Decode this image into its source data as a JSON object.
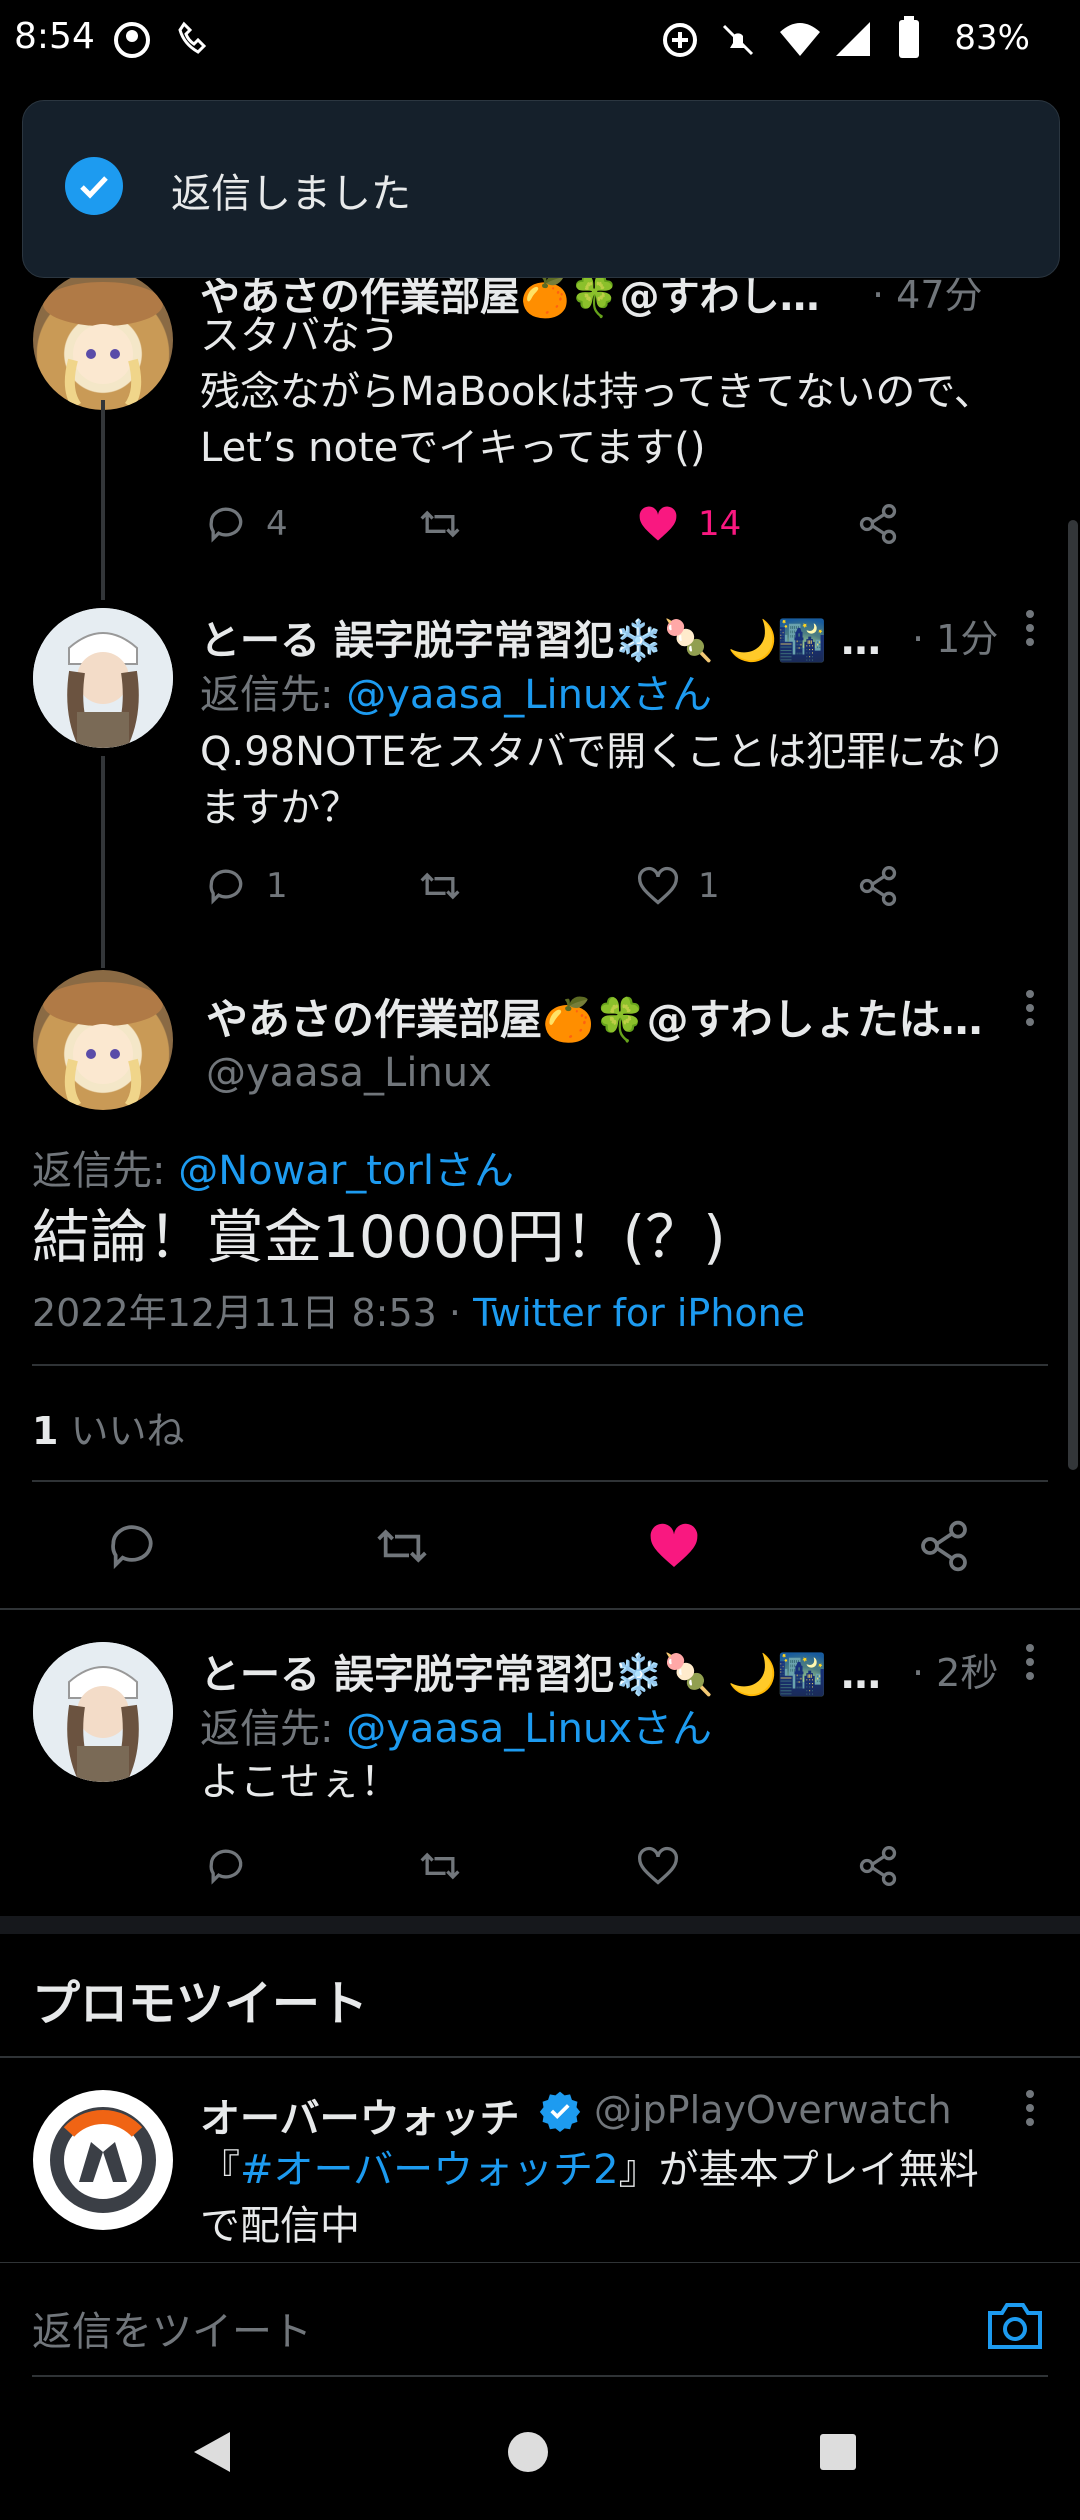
{
  "status": {
    "time": "8:54",
    "battery": "83%"
  },
  "toast": {
    "text": "返信しました"
  },
  "tweets": [
    {
      "author": "やあさの作業部屋🍊🍀@すわし…",
      "time": "· 47分",
      "lines": [
        "スタバなう",
        "残念ながらMaBookは持ってきてないので、",
        "Let’s noteでイキってます()"
      ],
      "replies": "4",
      "likes": "14"
    },
    {
      "author": "とーる 誤字脱字常習犯❄️🍡 🌙🌃 …",
      "time": "· 1分",
      "reply_to_prefix": "返信先: ",
      "reply_to": "@yaasa_Linuxさん",
      "lines": [
        "Q.98NOTEをスタバで開くことは犯罪になり",
        "ますか？"
      ],
      "replies": "1",
      "likes": "1"
    }
  ],
  "main_tweet": {
    "author": "やあさの作業部屋🍊🍀@すわしょたは…",
    "handle": "@yaasa_Linux",
    "reply_to_prefix": "返信先: ",
    "reply_to": "@Nowar_torlさん",
    "text": "結論！賞金10000円！(？)",
    "date": "2022年12月11日 8:53 · ",
    "source": "Twitter for iPhone",
    "likes_count": "1",
    "likes_label": " いいね"
  },
  "reply_tweet": {
    "author": "とーる 誤字脱字常習犯❄️🍡 🌙🌃 …",
    "time": "· 2秒",
    "reply_to_prefix": "返信先: ",
    "reply_to": "@yaasa_Linuxさん",
    "text": "よこせぇ！"
  },
  "promo": {
    "header": "プロモツイート",
    "author": "オーバーウォッチ",
    "handle": "@jpPlayOverwatch",
    "text_pre": "『",
    "hashtag": "#オーバーウォッチ2",
    "text_post": "』が基本プレイ無料",
    "line2": "で配信中"
  },
  "reply_bar": {
    "placeholder": "返信をツイート"
  },
  "colors": {
    "accent": "#1d9bf0",
    "like": "#f91880",
    "bg": "#000000",
    "toast_bg": "#15202b"
  },
  "icons": [
    "reply-icon",
    "retweet-icon",
    "like-icon",
    "share-icon",
    "camera-icon",
    "check-icon",
    "kebab-icon",
    "back-icon",
    "home-icon",
    "recents-icon",
    "verified-icon"
  ]
}
